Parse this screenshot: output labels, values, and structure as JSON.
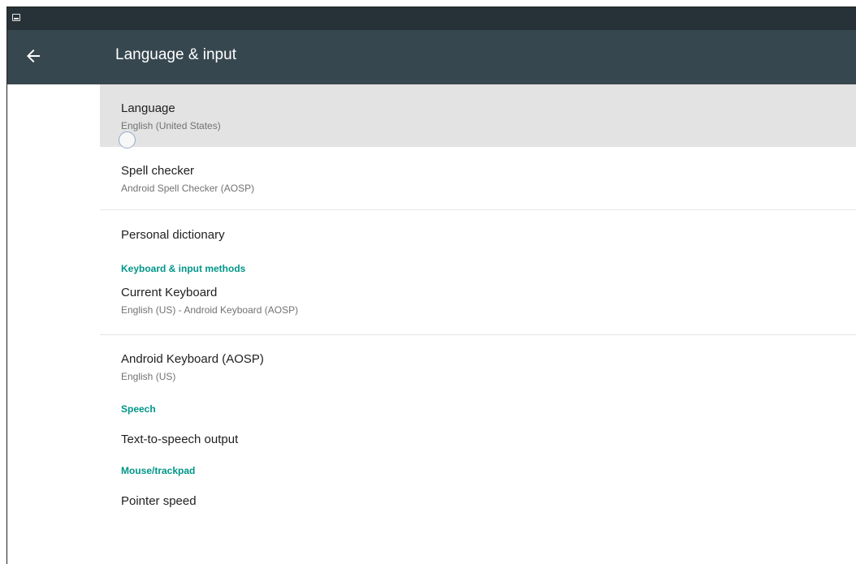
{
  "app_bar": {
    "title": "Language & input"
  },
  "items": {
    "language": {
      "title": "Language",
      "summary": "English (United States)"
    },
    "spell_checker": {
      "title": "Spell checker",
      "summary": "Android Spell Checker (AOSP)"
    },
    "personal_dictionary": {
      "title": "Personal dictionary"
    },
    "current_keyboard": {
      "title": "Current Keyboard",
      "summary": "English (US) - Android Keyboard (AOSP)"
    },
    "android_keyboard": {
      "title": "Android Keyboard (AOSP)",
      "summary": "English (US)"
    },
    "tts_output": {
      "title": "Text-to-speech output"
    },
    "pointer_speed": {
      "title": "Pointer speed"
    }
  },
  "headers": {
    "keyboard": "Keyboard & input methods",
    "speech": "Speech",
    "mouse": "Mouse/trackpad"
  },
  "colors": {
    "status_bar": "#263238",
    "app_bar": "#37474f",
    "accent": "#009688",
    "selected_row": "#e3e3e3"
  },
  "icons": {
    "back": "arrow-back-icon",
    "status": "screenshot-notification-icon"
  }
}
